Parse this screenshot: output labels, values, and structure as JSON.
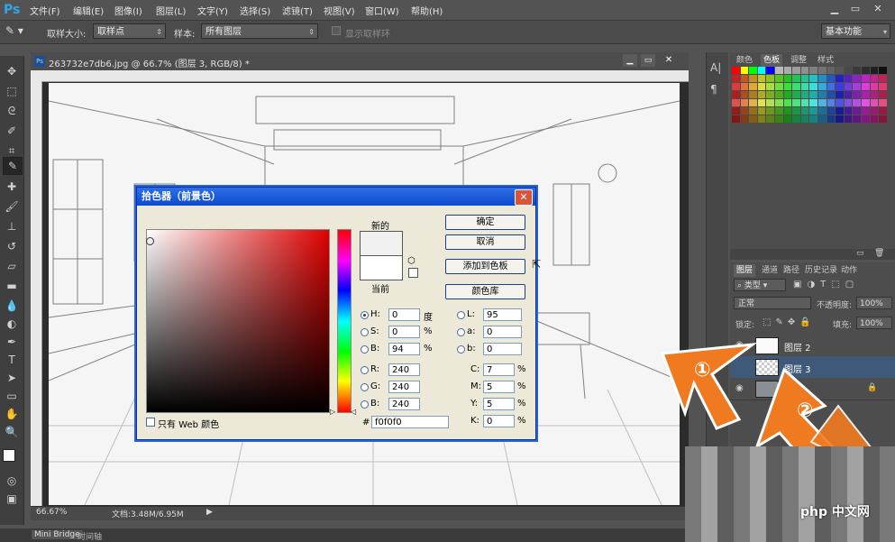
{
  "app": {
    "logo": "Ps"
  },
  "menu": [
    "文件(F)",
    "编辑(E)",
    "图像(I)",
    "图层(L)",
    "文字(Y)",
    "选择(S)",
    "滤镜(T)",
    "视图(V)",
    "窗口(W)",
    "帮助(H)"
  ],
  "options": {
    "sample_size_label": "取样大小:",
    "sample_size_value": "取样点",
    "sample_label": "样本:",
    "sample_value": "所有图层",
    "show_ring_label": "显示取样环",
    "workspace": "基本功能"
  },
  "document": {
    "tab_title": "263732e7db6.jpg @ 66.7% (图层 3, RGB/8) *",
    "zoom": "66.67%",
    "doc_size": "文档:3.48M/6.95M"
  },
  "bottom_tabs": [
    "Mini Bridge",
    "时间轴"
  ],
  "color_picker": {
    "title": "拾色器（前景色）",
    "new_label": "新的",
    "current_label": "当前",
    "ok": "确定",
    "cancel": "取消",
    "add_to_swatches": "添加到色板",
    "color_libraries": "颜色库",
    "web_only": "只有 Web 颜色",
    "new_color": "#f0f0f0",
    "current_color": "#ffffff",
    "fields": {
      "H": {
        "label": "H:",
        "value": "0",
        "unit": "度"
      },
      "S": {
        "label": "S:",
        "value": "0",
        "unit": "%"
      },
      "B": {
        "label": "B:",
        "value": "94",
        "unit": "%"
      },
      "R": {
        "label": "R:",
        "value": "240"
      },
      "G": {
        "label": "G:",
        "value": "240"
      },
      "Bl": {
        "label": "B:",
        "value": "240"
      },
      "L": {
        "label": "L:",
        "value": "95"
      },
      "a": {
        "label": "a:",
        "value": "0"
      },
      "b": {
        "label": "b:",
        "value": "0"
      },
      "C": {
        "label": "C:",
        "value": "7",
        "unit": "%"
      },
      "M": {
        "label": "M:",
        "value": "5",
        "unit": "%"
      },
      "Y": {
        "label": "Y:",
        "value": "5",
        "unit": "%"
      },
      "K": {
        "label": "K:",
        "value": "0",
        "unit": "%"
      },
      "hex_label": "#",
      "hex": "f0f0f0"
    }
  },
  "swatches_panel": {
    "tabs": [
      "颜色",
      "色板",
      "调整",
      "样式"
    ]
  },
  "layers_panel": {
    "tabs": [
      "图层",
      "通道",
      "路径",
      "历史记录",
      "动作"
    ],
    "kind": "类型",
    "blend_mode": "正常",
    "opacity_label": "不透明度:",
    "opacity": "100%",
    "lock_label": "锁定:",
    "fill_label": "填充:",
    "fill": "100%",
    "layers": [
      {
        "name": "图层 2"
      },
      {
        "name": "图层 3"
      },
      {
        "name": ""
      }
    ]
  },
  "annotations": {
    "one": "①",
    "two": "②"
  },
  "watermark": "php 中文网"
}
